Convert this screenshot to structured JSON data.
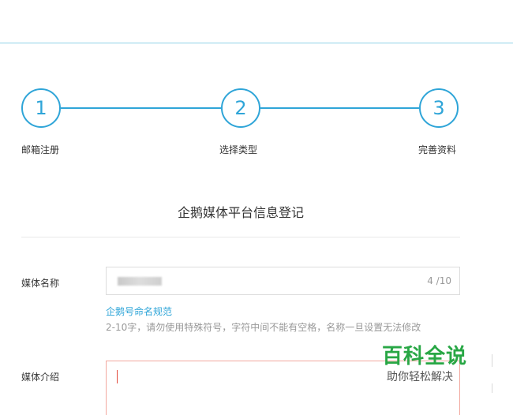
{
  "stepper": {
    "steps": [
      {
        "number": "1",
        "label": "邮箱注册"
      },
      {
        "number": "2",
        "label": "选择类型"
      },
      {
        "number": "3",
        "label": "完善资料"
      }
    ]
  },
  "form": {
    "title": "企鹅媒体平台信息登记",
    "media_name": {
      "label": "媒体名称",
      "char_count": "4 /10",
      "link_text": "企鹅号命名规范",
      "hint": "2-10字，请勿使用特殊符号，字符中间不能有空格，名称一旦设置无法修改"
    },
    "media_intro": {
      "label": "媒体介绍"
    }
  },
  "watermark": {
    "title": "百科全说",
    "subtitle": "助你轻松解决"
  },
  "colors": {
    "accent": "#2fa5d8",
    "error_border": "#f2a89f",
    "watermark_green": "#28a745"
  }
}
